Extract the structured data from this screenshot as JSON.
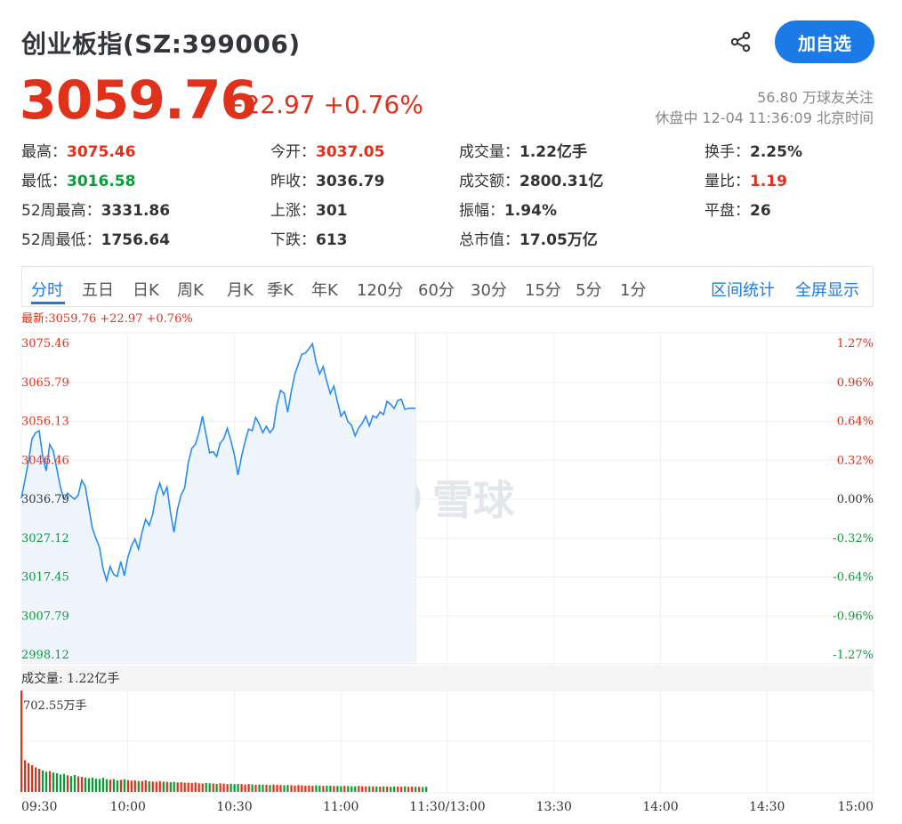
{
  "header": {
    "title": "创业板指(SZ:399006)",
    "add_label": "加自选",
    "price": "3059.76",
    "change": "+22.97",
    "change_pct": "+0.76%",
    "followers": "56.80 万球友关注",
    "status": "休盘中 12-04 11:36:09 北京时间"
  },
  "stats": [
    {
      "label": "最高：",
      "value": "3075.46",
      "color": "red"
    },
    {
      "label": "今开：",
      "value": "3037.05",
      "color": "red"
    },
    {
      "label": "成交量：",
      "value": "1.22亿手",
      "color": ""
    },
    {
      "label": "换手：",
      "value": "2.25%",
      "color": ""
    },
    {
      "label": "最低：",
      "value": "3016.58",
      "color": "green"
    },
    {
      "label": "昨收：",
      "value": "3036.79",
      "color": ""
    },
    {
      "label": "成交额：",
      "value": "2800.31亿",
      "color": ""
    },
    {
      "label": "量比：",
      "value": "1.19",
      "color": "red"
    },
    {
      "label": "52周最高：",
      "value": "3331.86",
      "color": ""
    },
    {
      "label": "上涨：",
      "value": "301",
      "color": ""
    },
    {
      "label": "振幅：",
      "value": "1.94%",
      "color": ""
    },
    {
      "label": "平盘：",
      "value": "26",
      "color": ""
    },
    {
      "label": "52周最低：",
      "value": "1756.64",
      "color": ""
    },
    {
      "label": "下跌：",
      "value": "613",
      "color": ""
    },
    {
      "label": "总市值：",
      "value": "17.05万亿",
      "color": ""
    }
  ],
  "tabs": [
    "分时",
    "五日",
    "日K",
    "周K",
    "月K",
    "季K",
    "年K",
    "120分",
    "60分",
    "30分",
    "15分",
    "5分",
    "1分"
  ],
  "tabs_right": [
    "区间统计",
    "全屏显示"
  ],
  "icons": {
    "share": "share-icon"
  },
  "colors": {
    "up": "#e0311b",
    "down": "#0c9b3a",
    "accent": "#1b7ae6",
    "line": "#2a8cf0"
  },
  "chart_data": {
    "type": "line",
    "latest_label": "最新:3059.76 +22.97 +0.76%",
    "watermark": "雪球",
    "y_left_ticks": [
      "3075.46",
      "3065.79",
      "3056.13",
      "3046.46",
      "3036.79",
      "3027.12",
      "3017.45",
      "3007.79",
      "2998.12"
    ],
    "y_right_ticks": [
      "1.27%",
      "0.96%",
      "0.64%",
      "0.32%",
      "0.00%",
      "-0.32%",
      "-0.64%",
      "-0.96%",
      "-1.27%"
    ],
    "ylim": [
      2998.12,
      3075.46
    ],
    "base_close": 3036.79,
    "volume_label": "成交量: 1.22亿手",
    "volume_max_label": "702.55万手",
    "volume_max": 702.55,
    "x_ticks": [
      "09:30",
      "10:00",
      "10:30",
      "11:00",
      "11:30/13:00",
      "13:30",
      "14:00",
      "14:30",
      "15:00"
    ],
    "total_minutes": 240,
    "price_series": [
      3037.0,
      3041.5,
      3046.2,
      3051.8,
      3053.3,
      3053.8,
      3047.4,
      3043.8,
      3050.4,
      3048.8,
      3044.3,
      3039.8,
      3036.8,
      3038.3,
      3037.5,
      3036.8,
      3037.8,
      3041.5,
      3040.0,
      3034.8,
      3029.6,
      3027.1,
      3024.9,
      3019.6,
      3016.6,
      3020.1,
      3018.1,
      3017.6,
      3021.3,
      3017.8,
      3022.4,
      3025.2,
      3026.9,
      3024.4,
      3028.6,
      3031.8,
      3030.3,
      3033.1,
      3038.1,
      3040.8,
      3037.9,
      3039.8,
      3033.4,
      3028.6,
      3034.4,
      3037.9,
      3039.6,
      3045.8,
      3049.4,
      3050.4,
      3053.3,
      3057.4,
      3052.9,
      3048.3,
      3048.6,
      3047.4,
      3050.7,
      3051.8,
      3054.4,
      3051.4,
      3047.8,
      3042.8,
      3047.4,
      3051.1,
      3054.2,
      3053.8,
      3057.1,
      3055.5,
      3053.3,
      3054.9,
      3053.3,
      3054.4,
      3060.3,
      3063.8,
      3063.1,
      3058.4,
      3063.5,
      3067.8,
      3070.3,
      3072.8,
      3073.1,
      3074.2,
      3075.4,
      3070.8,
      3067.9,
      3069.7,
      3066.1,
      3063.0,
      3064.9,
      3061.1,
      3057.4,
      3058.6,
      3056.0,
      3055.2,
      3052.5,
      3054.5,
      3055.7,
      3057.4,
      3055.0,
      3057.5,
      3057.0,
      3058.5,
      3057.8,
      3061.1,
      3060.4,
      3059.3,
      3061.3,
      3061.6,
      3059.1,
      3059.3,
      3059.4,
      3059.3
    ],
    "volume_series": [
      702.55,
      220,
      200,
      185,
      170,
      160,
      150,
      140,
      145,
      135,
      130,
      120,
      125,
      115,
      110,
      118,
      108,
      105,
      100,
      95,
      100,
      92,
      90,
      98,
      88,
      85,
      90,
      80,
      84,
      88,
      82,
      78,
      80,
      76,
      75,
      80,
      74,
      72,
      70,
      75,
      72,
      70,
      68,
      70,
      66,
      68,
      64,
      65,
      62,
      66,
      60,
      58,
      62,
      60,
      58,
      56,
      60,
      58,
      55,
      57,
      54,
      56,
      55,
      52,
      55,
      53,
      50,
      52,
      51,
      50,
      48,
      52,
      50,
      48,
      46,
      48,
      47,
      45,
      48,
      46,
      44,
      45,
      43,
      46,
      44,
      42,
      44,
      43,
      41,
      42,
      40,
      42,
      41,
      40,
      39,
      42,
      40,
      38,
      40,
      39,
      38,
      37,
      39,
      38,
      36,
      38,
      37,
      36,
      38,
      35,
      37,
      36,
      35,
      34,
      36
    ]
  }
}
